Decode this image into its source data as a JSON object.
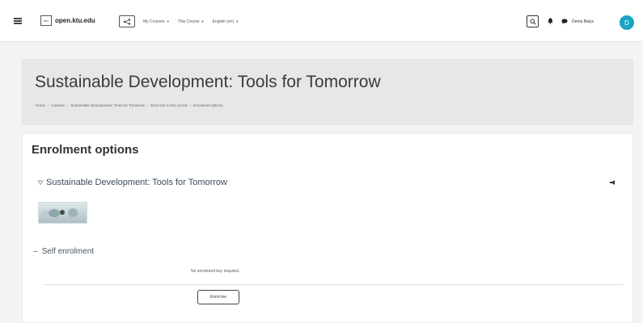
{
  "navbar": {
    "brand_logo_text": "ktu",
    "brand_name": "open.ktu.edu",
    "menus": [
      {
        "label": "My Courses"
      },
      {
        "label": "This Course"
      },
      {
        "label": "English (en)"
      }
    ],
    "user_name": "Dema Balys",
    "avatar_initial": "D",
    "avatar_color": "#1aa3c4"
  },
  "header": {
    "title": "Sustainable Development: Tools for Tomorrow",
    "breadcrumb": [
      "Home",
      "Courses",
      "Sustainable Development: Tools for Tomorrow",
      "Enrol me in this course",
      "Enrolment options"
    ]
  },
  "main": {
    "heading": "Enrolment options",
    "course_title": "Sustainable Development: Tools for Tomorrow",
    "section_label": "Self enrolment",
    "key_note": "No enrolment key required.",
    "enrol_button": "Enrol me"
  }
}
